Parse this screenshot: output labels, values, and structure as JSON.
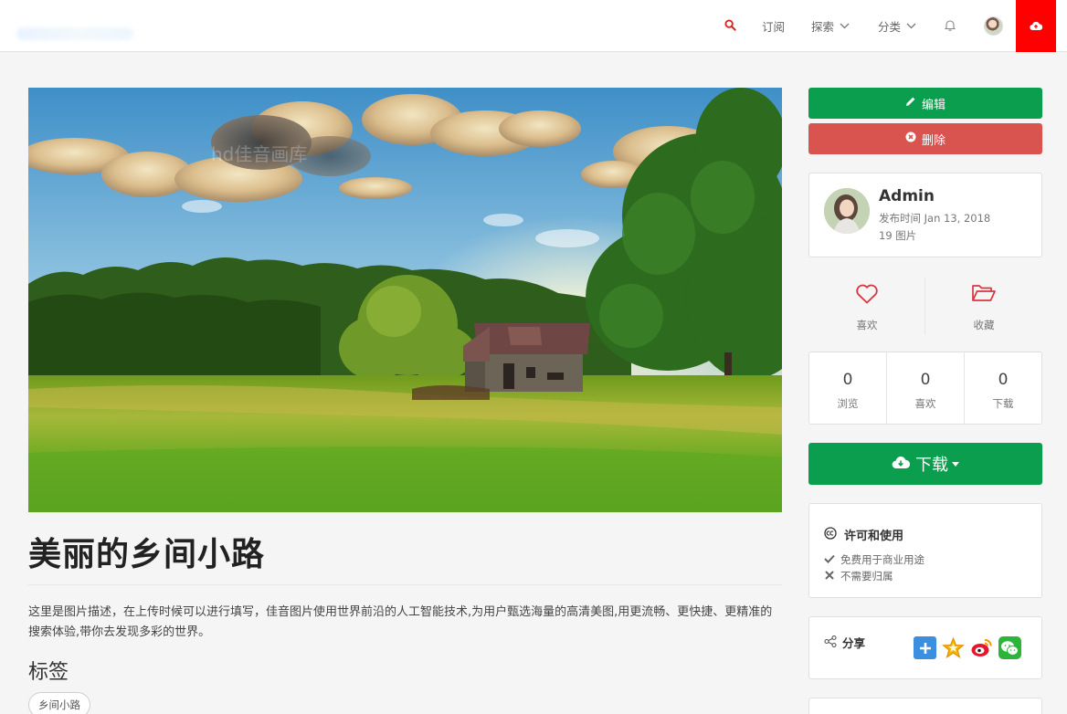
{
  "nav": {
    "subscribe": "订阅",
    "explore": "探索",
    "category": "分类"
  },
  "photo": {
    "title": "美丽的乡间小路",
    "description": "这里是图片描述，在上传时候可以进行填写，佳音图片使用世界前沿的人工智能技术,为用户甄选海量的高清美图,用更流畅、更快捷、更精准的搜索体验,带你去发现多彩的世界。",
    "tags_heading": "标签",
    "tags": [
      "乡间小路"
    ]
  },
  "buttons": {
    "edit": "编辑",
    "delete": "删除",
    "download": "下载"
  },
  "author": {
    "name": "Admin",
    "published": "发布时间 Jan 13, 2018",
    "count": "19 图片"
  },
  "actions": {
    "like": "喜欢",
    "favorite": "收藏"
  },
  "stats": [
    {
      "value": "0",
      "label": "浏览"
    },
    {
      "value": "0",
      "label": "喜欢"
    },
    {
      "value": "0",
      "label": "下载"
    }
  ],
  "license": {
    "title": "许可和使用",
    "items": [
      "免费用于商业用途",
      "不需要归属"
    ]
  },
  "share": {
    "title": "分享"
  },
  "colors": {
    "accent_green": "#0c9e4f",
    "danger_red": "#d9534f",
    "upload_red": "#ff0000",
    "nav_search_red": "#e02020"
  },
  "icons": [
    "search-icon",
    "chevron-down-icon",
    "bell-icon",
    "upload-cloud-icon",
    "pencil-icon",
    "times-circle-icon",
    "heart-icon",
    "folder-open-icon",
    "download-cloud-icon",
    "creative-commons-icon",
    "check-icon",
    "x-icon",
    "share-icon",
    "qzone-icon",
    "star-icon",
    "weibo-icon",
    "wechat-icon"
  ]
}
